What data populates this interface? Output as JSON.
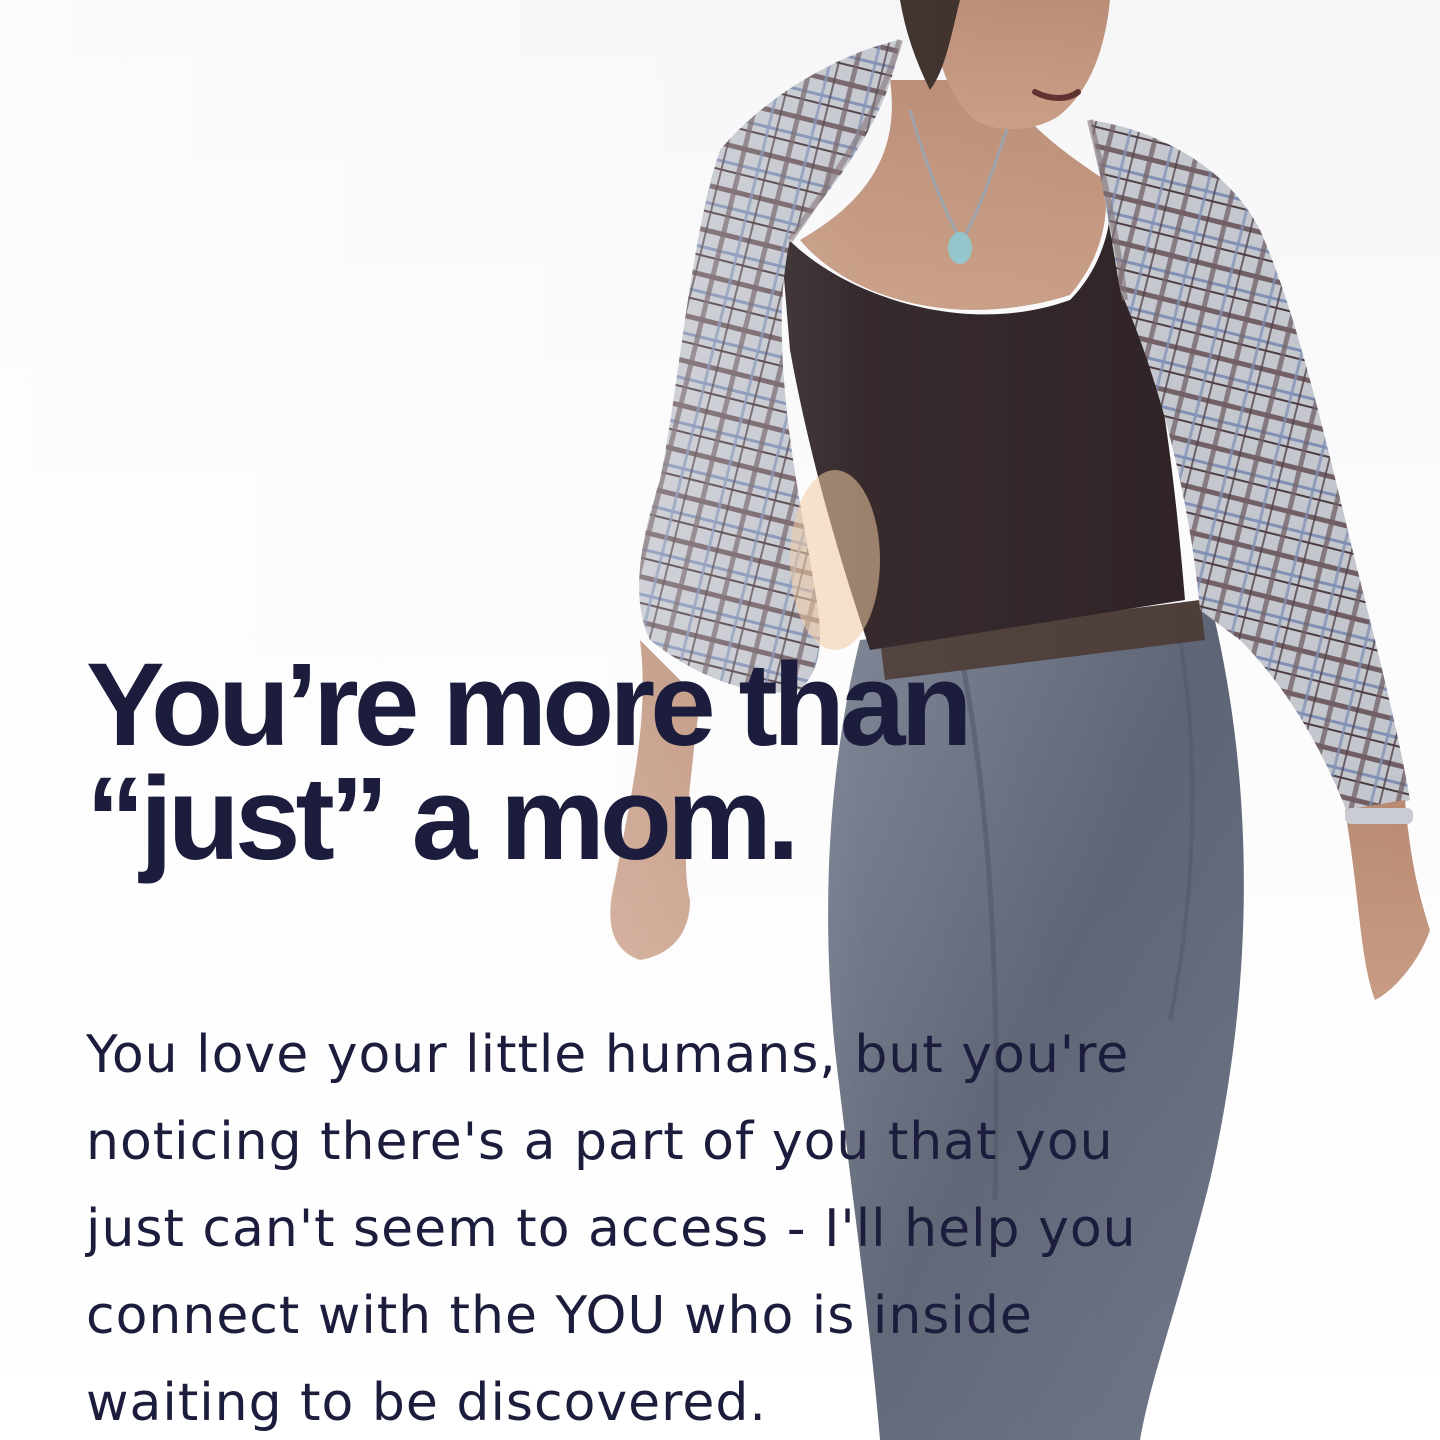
{
  "hero": {
    "headline_lines": [
      "You’re more than",
      "“just” a mom."
    ],
    "body_lines": [
      "You love your little humans, but you're",
      "noticing there's a part of you that you",
      "just can't seem to access - I'll help you",
      "connect with the YOU who is inside",
      "waiting to be discovered."
    ]
  },
  "colors": {
    "text": "#1c1d3c",
    "background": "#ffffff",
    "top": "#2b1f22",
    "jeans": "#5c6372",
    "plaid": "#b7b9c2"
  }
}
